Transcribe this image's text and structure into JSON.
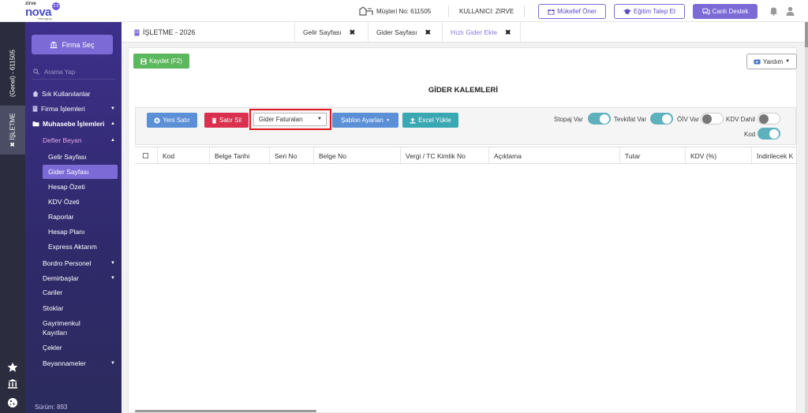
{
  "header": {
    "logo_brand": "zirve",
    "logo_name": "nova",
    "logo_version": "2.0",
    "logo_sub": "mikrogrup",
    "customer": "Müşteri No: 611505",
    "user": "KULLANICI: ZIRVE",
    "buttons": {
      "mukellef": "Mükellef Öner",
      "egitim": "Eğitim Talep Et",
      "destek": "Canlı Destek"
    }
  },
  "rail": {
    "genel": "(Genel) - 611505",
    "isletme": "✖ İŞLETME"
  },
  "sidebar": {
    "firma_sec": "Firma Seç",
    "search_placeholder": "Arama Yap",
    "items": {
      "sik": "Sık Kullanılanlar",
      "firma": "Firma İşlemleri",
      "muhasebe": "Muhasebe İşlemleri",
      "defter": "Defter Beyan",
      "gelir": "Gelir Sayfası",
      "gider": "Gider Sayfası",
      "hesap_ozeti": "Hesap Özeti",
      "kdv_ozeti": "KDV Özeti",
      "raporlar": "Raporlar",
      "hesap_plani": "Hesap Planı",
      "express": "Express Aktarım",
      "bordro": "Bordro Personel",
      "demirbas": "Demirbaşlar",
      "cariler": "Cariler",
      "stoklar": "Stoklar",
      "gayrimenkul_1": "Gayrimenkul",
      "gayrimenkul_2": "Kayıtları",
      "cekler": "Çekler",
      "beyannameler": "Beyannameler"
    },
    "version": "Sürüm: 893"
  },
  "tabs": {
    "title": "İŞLETME - 2026",
    "list": [
      "Gelir Sayfası",
      "Gider Sayfası",
      "Hızlı Gider Ekle"
    ]
  },
  "main": {
    "kaydet": "Kaydet (F2)",
    "yardim": "Yardım",
    "heading": "GİDER KALEMLERİ",
    "toolbar": {
      "yeni": "Yeni Satır",
      "sil": "Satır Sil",
      "select_value": "Gider Faturaları",
      "sablon": "Şablon Ayarları",
      "excel": "Excel Yükle"
    },
    "toggles": {
      "stopaj": "Stopaj Var",
      "tevkifat": "Tevkifat Var",
      "oiv": "ÖİV Var",
      "kdv_dahil": "KDV Dahil",
      "kod": "Kod",
      "states": {
        "stopaj": true,
        "tevkifat": true,
        "oiv": false,
        "kdv_dahil": false,
        "kod": true
      }
    },
    "columns": [
      "Kod",
      "Belge Tarihi",
      "Seri No",
      "Belge No",
      "Vergi / TC Kimlik No",
      "Açıklama",
      "Tutar",
      "KDV (%)",
      "İndirilecek K"
    ]
  },
  "colors": {
    "accent": "#7c6bd6",
    "sidebar": "#3d2f8a",
    "rail": "#2b2d3e",
    "save": "#5cb85c",
    "danger": "#d9304f",
    "highlight": "#e0191e",
    "toggle_on": "#5fb0bd"
  }
}
